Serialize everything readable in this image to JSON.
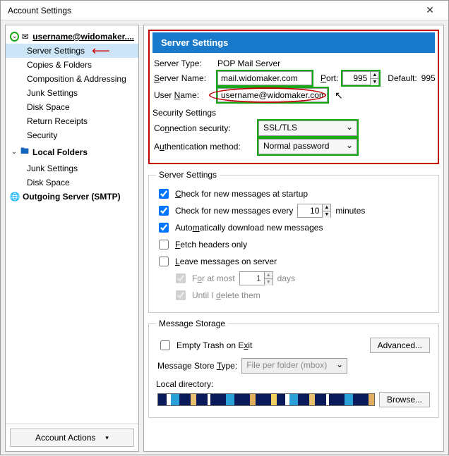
{
  "window": {
    "title": "Account Settings"
  },
  "sidebar": {
    "account_label": "username@widomaker....",
    "items": [
      "Server Settings",
      "Copies & Folders",
      "Composition & Addressing",
      "Junk Settings",
      "Disk Space",
      "Return Receipts",
      "Security"
    ],
    "local_folders_label": "Local Folders",
    "local_items": [
      "Junk Settings",
      "Disk Space"
    ],
    "outgoing_label": "Outgoing Server (SMTP)",
    "actions_label": "Account Actions"
  },
  "panel": {
    "header": "Server Settings",
    "server_type_label": "Server Type:",
    "server_type_value": "POP Mail Server",
    "server_name_label": "Server Name:",
    "server_name_value": "mail.widomaker.com",
    "port_label": "Port:",
    "port_value": "995",
    "default_label": "Default:",
    "default_value": "995",
    "user_name_label": "User Name:",
    "user_name_value": "username@widomaker.com",
    "security_title": "Security Settings",
    "conn_sec_label": "Connection security:",
    "conn_sec_value": "SSL/TLS",
    "auth_label": "Authentication method:",
    "auth_value": "Normal password"
  },
  "server_settings": {
    "legend": "Server Settings",
    "check_startup": "Check for new messages at startup",
    "check_every_pre": "Check for new messages every",
    "check_every_value": "10",
    "check_every_post": "minutes",
    "auto_download": "Automatically download new messages",
    "fetch_headers": "Fetch headers only",
    "leave_on_server": "Leave messages on server",
    "for_at_most": "For at most",
    "for_at_most_value": "1",
    "for_at_most_post": "days",
    "until_delete": "Until I delete them"
  },
  "storage": {
    "legend": "Message Storage",
    "empty_trash": "Empty Trash on Exit",
    "advanced": "Advanced...",
    "store_type_label": "Message Store Type:",
    "store_type_value": "File per folder (mbox)",
    "local_dir_label": "Local directory:",
    "browse": "Browse..."
  }
}
